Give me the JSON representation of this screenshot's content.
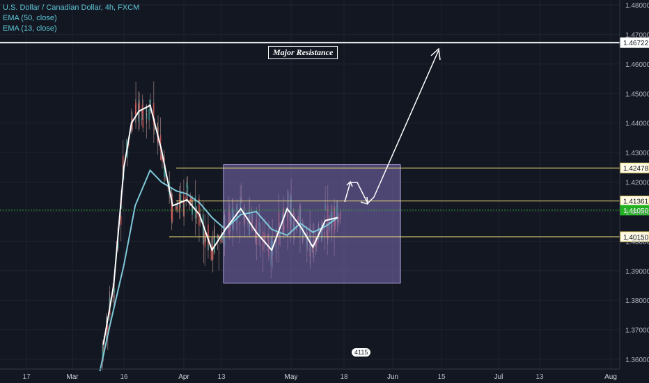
{
  "legend": {
    "title": "U.S. Dollar / Canadian Dollar, 4h, FXCM",
    "ema50": "EMA (50, close)",
    "ema13": "EMA (13, close)"
  },
  "annotation": "Major Resistance",
  "event_badge": "4115",
  "chart_data": {
    "type": "line",
    "title": "U.S. Dollar / Canadian Dollar, 4h, FXCM",
    "xlabel": "",
    "ylabel": "",
    "ylim": [
      1.356,
      1.482
    ],
    "x_ticks": [
      "17",
      "Mar",
      "16",
      "Apr",
      "13",
      "May",
      "18",
      "Jun",
      "15",
      "Jul",
      "13",
      "Aug"
    ],
    "y_ticks": [
      "1.48000",
      "1.47000",
      "1.46000",
      "1.45000",
      "1.44000",
      "1.43000",
      "1.42000",
      "1.41000",
      "1.40000",
      "1.39000",
      "1.38000",
      "1.37000",
      "1.36000"
    ],
    "series": [
      {
        "name": "EMA (50, close)",
        "color": "#7fc9d9",
        "x": [
          "2020-03-09",
          "2020-03-12",
          "2020-03-16",
          "2020-03-19",
          "2020-03-23",
          "2020-03-26",
          "2020-03-30",
          "2020-04-02",
          "2020-04-06",
          "2020-04-10",
          "2020-04-14",
          "2020-04-18",
          "2020-04-22",
          "2020-04-26",
          "2020-04-30",
          "2020-05-04",
          "2020-05-08",
          "2020-05-12",
          "2020-05-16"
        ],
        "values": [
          1.356,
          1.372,
          1.392,
          1.412,
          1.424,
          1.42,
          1.417,
          1.416,
          1.413,
          1.408,
          1.404,
          1.409,
          1.41,
          1.404,
          1.402,
          1.406,
          1.403,
          1.405,
          1.408
        ]
      },
      {
        "name": "EMA (13, close)",
        "color": "#ffffff",
        "x": [
          "2020-03-10",
          "2020-03-13",
          "2020-03-16",
          "2020-03-18",
          "2020-03-20",
          "2020-03-23",
          "2020-03-26",
          "2020-03-29",
          "2020-04-02",
          "2020-04-06",
          "2020-04-10",
          "2020-04-14",
          "2020-04-18",
          "2020-04-22",
          "2020-04-26",
          "2020-04-30",
          "2020-05-04",
          "2020-05-08",
          "2020-05-12",
          "2020-05-16"
        ],
        "values": [
          1.365,
          1.385,
          1.425,
          1.44,
          1.444,
          1.446,
          1.431,
          1.412,
          1.414,
          1.409,
          1.397,
          1.404,
          1.411,
          1.403,
          1.397,
          1.411,
          1.405,
          1.398,
          1.407,
          1.408
        ]
      }
    ],
    "horizontal_levels": [
      {
        "label": "1.46722",
        "value": 1.46722,
        "color": "#ffffff"
      },
      {
        "label": "1.42478",
        "value": 1.42478,
        "color": "#f5e37a"
      },
      {
        "label": "1.41361",
        "value": 1.41361,
        "color": "#f5e37a"
      },
      {
        "label": "1.41050",
        "value": 1.4105,
        "color": "#26c226"
      },
      {
        "label": "1.40150",
        "value": 1.4015,
        "color": "#f5e37a"
      }
    ],
    "range_box": {
      "x_start": "2020-04-13",
      "x_end": "2020-06-01",
      "y_top": 1.4259,
      "y_bottom": 1.3858
    },
    "last_price": 1.4105,
    "colors": {
      "background": "#131722",
      "up": "#26a69a",
      "down": "#ef5350",
      "box": "#7e6bb5"
    }
  }
}
